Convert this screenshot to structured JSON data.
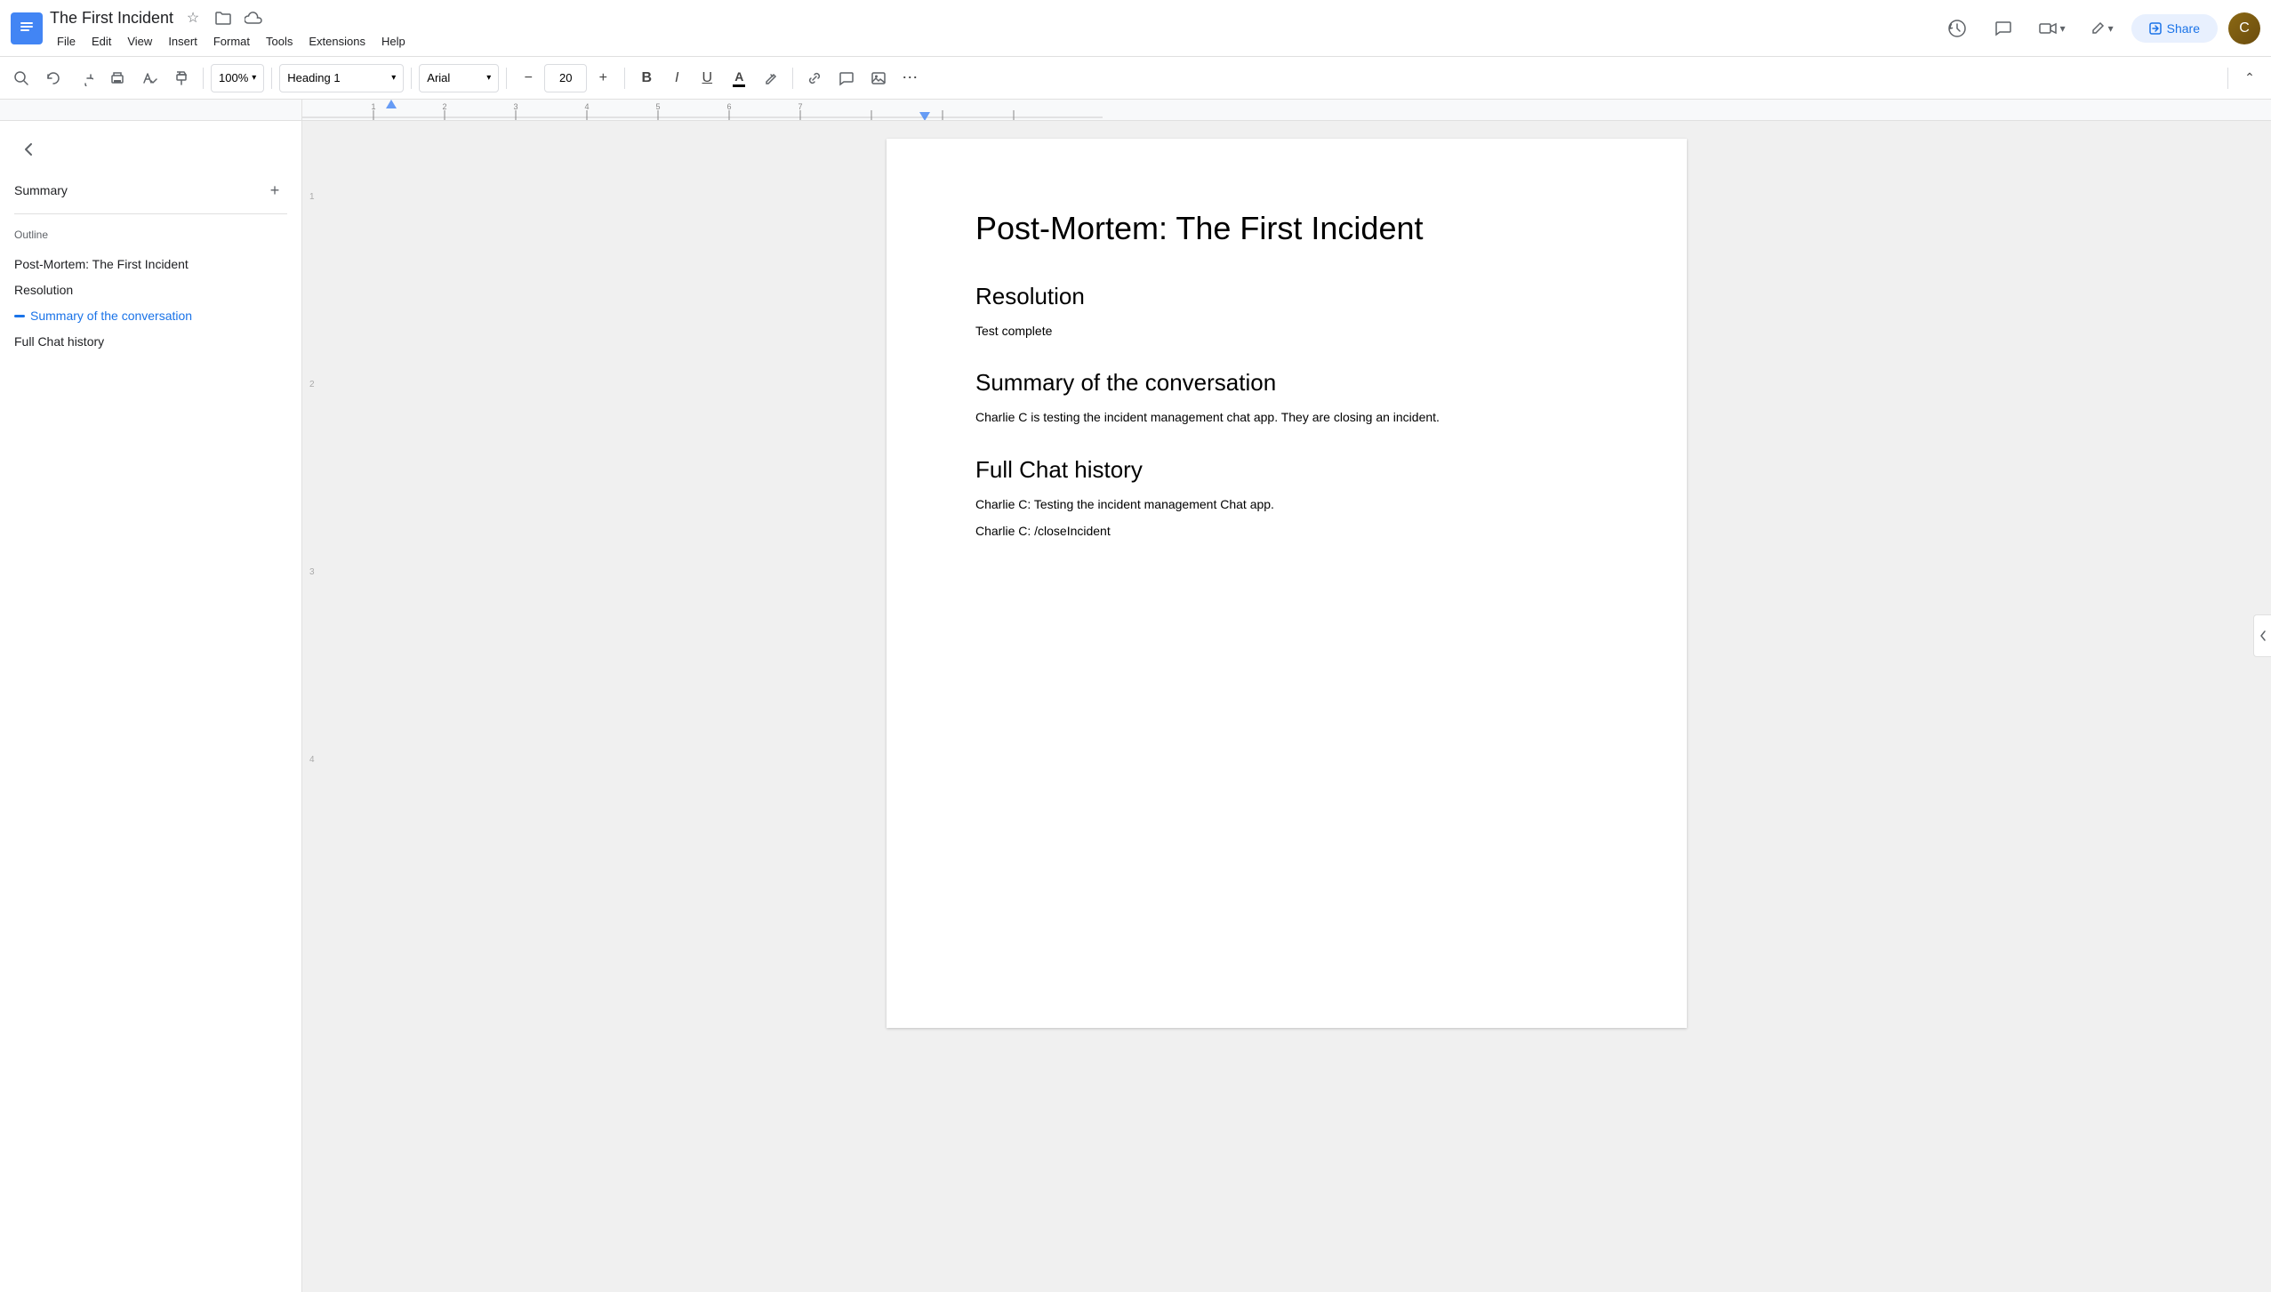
{
  "app": {
    "title": "The First Incident",
    "icon": "📄"
  },
  "title_bar": {
    "doc_title": "The First Incident",
    "star_icon": "☆",
    "folder_icon": "📁",
    "cloud_icon": "☁"
  },
  "menu": {
    "items": [
      "File",
      "Edit",
      "View",
      "Insert",
      "Format",
      "Tools",
      "Extensions",
      "Help"
    ]
  },
  "top_right": {
    "history_label": "⏱",
    "comments_label": "💬",
    "meet_label": "📹",
    "meet_dropdown": "▾",
    "edit_icon": "✏",
    "share_btn": "Share",
    "lock_icon": "🔒"
  },
  "toolbar": {
    "search_icon": "🔍",
    "undo_icon": "↩",
    "redo_icon": "↪",
    "print_icon": "🖨",
    "spellcheck_icon": "✓",
    "paintformat_icon": "🖌",
    "zoom_value": "100%",
    "zoom_dropdown": "▾",
    "style_label": "Heading 1",
    "style_dropdown": "▾",
    "font_label": "Arial",
    "font_dropdown": "▾",
    "font_size": "20",
    "decrease_font": "−",
    "increase_font": "+",
    "bold": "B",
    "italic": "I",
    "underline": "U",
    "text_color_icon": "A",
    "highlight_icon": "✏",
    "link_icon": "🔗",
    "comment_icon": "💬",
    "image_icon": "🖼",
    "more_icon": "⋯",
    "editing_icon": "✏",
    "editing_dropdown": "▾",
    "collapse_icon": "⌃"
  },
  "left_panel": {
    "back_icon": "←",
    "summary_label": "Summary",
    "add_icon": "+",
    "outline_label": "Outline",
    "outline_items": [
      {
        "text": "Post-Mortem: The First Incident",
        "active": false
      },
      {
        "text": "Resolution",
        "active": false
      },
      {
        "text": "Summary of the conversation",
        "active": true
      },
      {
        "text": "Full Chat history",
        "active": false
      }
    ]
  },
  "document": {
    "main_title": "Post-Mortem: The First Incident",
    "sections": [
      {
        "heading": "Resolution",
        "paragraphs": [
          "Test complete"
        ]
      },
      {
        "heading": "Summary of the conversation",
        "paragraphs": [
          "Charlie C is testing the incident management chat app. They are closing an incident."
        ]
      },
      {
        "heading": "Full Chat history",
        "paragraphs": [
          "Charlie C: Testing the incident management Chat app.",
          "Charlie C: /closeIncident"
        ]
      }
    ]
  }
}
